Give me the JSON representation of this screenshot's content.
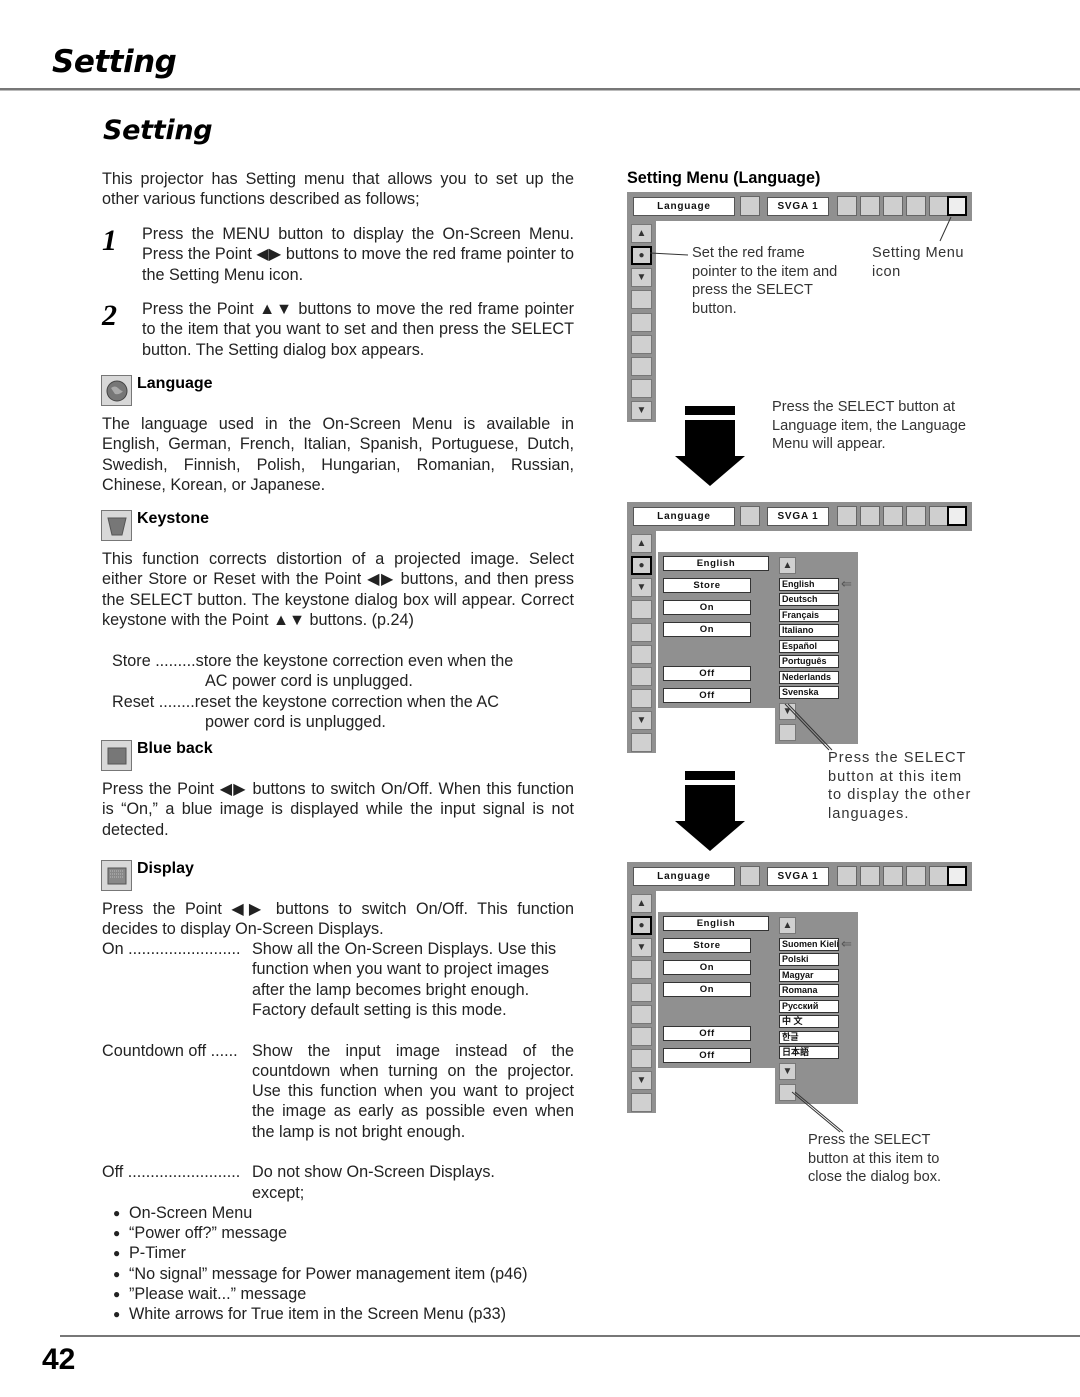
{
  "header": {
    "title": "Setting",
    "section_title": "Setting"
  },
  "intro": "This projector has Setting menu that allows you to set up the other various functions described as follows;",
  "steps": [
    {
      "num": "1",
      "text": "Press the MENU button to display the On-Screen Menu.  Press the Point ◀▶ buttons to move the red frame pointer to the Setting Menu icon."
    },
    {
      "num": "2",
      "text": "Press the Point ▲▼ buttons to move the red frame pointer to the item that you want to set and then press the SELECT button.  The Setting dialog box appears."
    }
  ],
  "sections": {
    "language": {
      "label": "Language",
      "icon": "globe-icon",
      "text": "The language used in the On-Screen Menu is available in English, German, French, Italian, Spanish, Portuguese, Dutch, Swedish, Finnish, Polish, Hungarian, Romanian, Russian, Chinese, Korean, or Japanese."
    },
    "keystone": {
      "label": "Keystone",
      "icon": "keystone-icon",
      "text": "This function corrects distortion of a projected image.  Select either Store or Reset with the Point ◀▶ buttons, and then press the SELECT button.  The keystone dialog box will appear.  Correct keystone with the Point ▲▼ buttons. (p.24)",
      "options": [
        {
          "term": "Store .........",
          "desc": "store the keystone correction even when the",
          "desc2": "AC power cord is unplugged."
        },
        {
          "term": "Reset ........",
          "desc": "reset the keystone correction when the AC",
          "desc2": "power cord is unplugged."
        }
      ]
    },
    "blue_back": {
      "label": "Blue back",
      "icon": "blue-back-icon",
      "text": "Press the Point ◀▶ buttons to switch On/Off.  When this function is “On,” a blue image is displayed while the input signal is not detected."
    },
    "display": {
      "label": "Display",
      "icon": "display-icon",
      "text": "Press the Point ◀▶ buttons to switch On/Off.  This function decides to display On-Screen Displays.",
      "options": [
        {
          "term": "On .........................",
          "desc": "Show all the On-Screen Displays.  Use this function when you want to project images after the lamp becomes bright enough.  Factory default setting is this mode."
        },
        {
          "term": "Countdown off ......",
          "desc": "Show the input image instead of the countdown when turning on the projector.  Use this function when you want to project the image as early as possible even when the lamp is not bright enough."
        },
        {
          "term": "Off .........................",
          "desc": "Do not show On-Screen Displays. except;"
        }
      ],
      "exceptions": [
        "On-Screen Menu",
        "“Power off?” message",
        "P-Timer",
        "“No signal” message for Power management item (p46)",
        "”Please wait...” message",
        "White arrows for True item in the Screen Menu (p33)"
      ]
    }
  },
  "right": {
    "heading": "Setting Menu (Language)",
    "osd": {
      "menu_label": "Language",
      "source_label": "SVGA 1",
      "sub_values": [
        "English",
        "Store",
        "On",
        "On",
        "Off",
        "Off"
      ],
      "languages_page1": [
        "English",
        "Deutsch",
        "Français",
        "Italiano",
        "Español",
        "Português",
        "Nederlands",
        "Svenska"
      ],
      "languages_page2": [
        "Suomen Kieli",
        "Polski",
        "Magyar",
        "Romana",
        "Русский",
        "中 文",
        "한글",
        "日本語"
      ]
    },
    "notes": {
      "frame_pointer": "Set the red frame pointer to the item and press the SELECT button.",
      "setting_icon": "Setting Menu icon",
      "select_language": "Press the SELECT button at Language item, the Language Menu will appear.",
      "other_languages": "Press the SELECT button at this item to display the other languages.",
      "close_dialog": "Press the SELECT button at this item to close the dialog box."
    }
  },
  "footer": {
    "page_number": "42"
  }
}
